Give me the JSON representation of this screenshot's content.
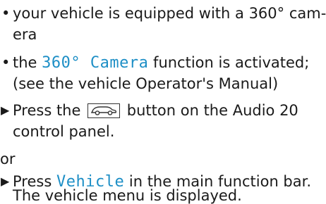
{
  "items": [
    {
      "bullet": "•",
      "text_a": "your vehicle is equipped with a 360° cam-",
      "text_b": "era"
    },
    {
      "bullet": "•",
      "pre": "the",
      "ui": "360° Camera",
      "post": "function is activated;",
      "text_b": "(see the vehicle Operator's Manual)"
    },
    {
      "arrow": "▶",
      "pre": "Press the",
      "post": "button on the Audio 20",
      "text_b": "control panel.",
      "icon": "car-icon"
    },
    {
      "or": "or"
    },
    {
      "arrow": "▶",
      "pre": "Press",
      "ui": "Vehicle",
      "post": "in the main function bar.",
      "text_b": "The vehicle menu is displayed."
    }
  ],
  "colors": {
    "ui_text": "#1e8fc6",
    "body_text": "#1a1a1a"
  }
}
